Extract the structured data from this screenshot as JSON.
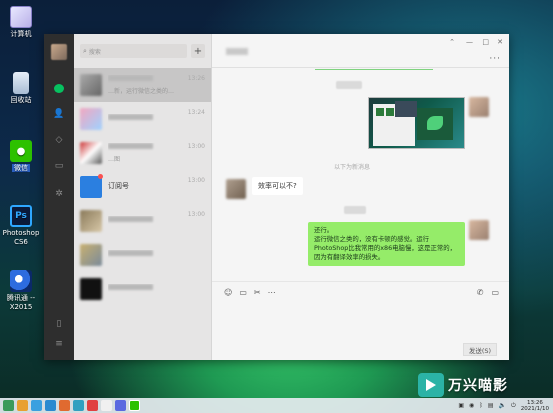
{
  "desktop": {
    "icons": [
      {
        "label": "计算机",
        "icon": "computer-icon"
      },
      {
        "label": "回收站",
        "icon": "recycle-bin-icon"
      },
      {
        "label": "微信",
        "icon": "wechat-icon"
      },
      {
        "label": "Photoshop CS6",
        "icon": "photoshop-icon",
        "glyph": "Ps"
      },
      {
        "label": "腾讯通 --X2015",
        "icon": "tencent-rtx-icon"
      }
    ]
  },
  "wechat": {
    "search": {
      "placeholder": "搜索",
      "icon": "search-icon"
    },
    "add_label": "+",
    "chats": [
      {
        "time": "13:26",
        "preview": "…新，运行微信之类的…",
        "selected": true
      },
      {
        "time": "13:24",
        "preview": ""
      },
      {
        "time": "13:00",
        "preview": "…图"
      },
      {
        "name": "订阅号",
        "time": "13:00",
        "preview": "",
        "unread": true
      },
      {
        "time": "13:00",
        "preview": ""
      },
      {
        "time": "",
        "preview": ""
      },
      {
        "time": "",
        "preview": ""
      }
    ],
    "window_controls": {
      "pin": "⌃",
      "minimize": "—",
      "maximize": "□",
      "close": "✕"
    },
    "more_label": "···",
    "system_message": "以下为新消息",
    "messages": {
      "incoming": "效率可以不?",
      "outgoing": "还行。\n运行微信之类的，没有卡顿的感觉。运行PhotoShop比我常用的x86电脑慢，这是正常的，因为有翻译效率的损失。"
    },
    "toolbar_icons": [
      "emoji-icon",
      "folder-icon",
      "scissors-icon",
      "chat-history-icon"
    ],
    "toolbar_right_icons": [
      "phone-icon",
      "video-call-icon"
    ],
    "send_label": "发送(S)"
  },
  "taskbar": {
    "clock_time": "13:26",
    "clock_date": "2021/1/10"
  },
  "watermark": {
    "text": "万兴喵影"
  }
}
